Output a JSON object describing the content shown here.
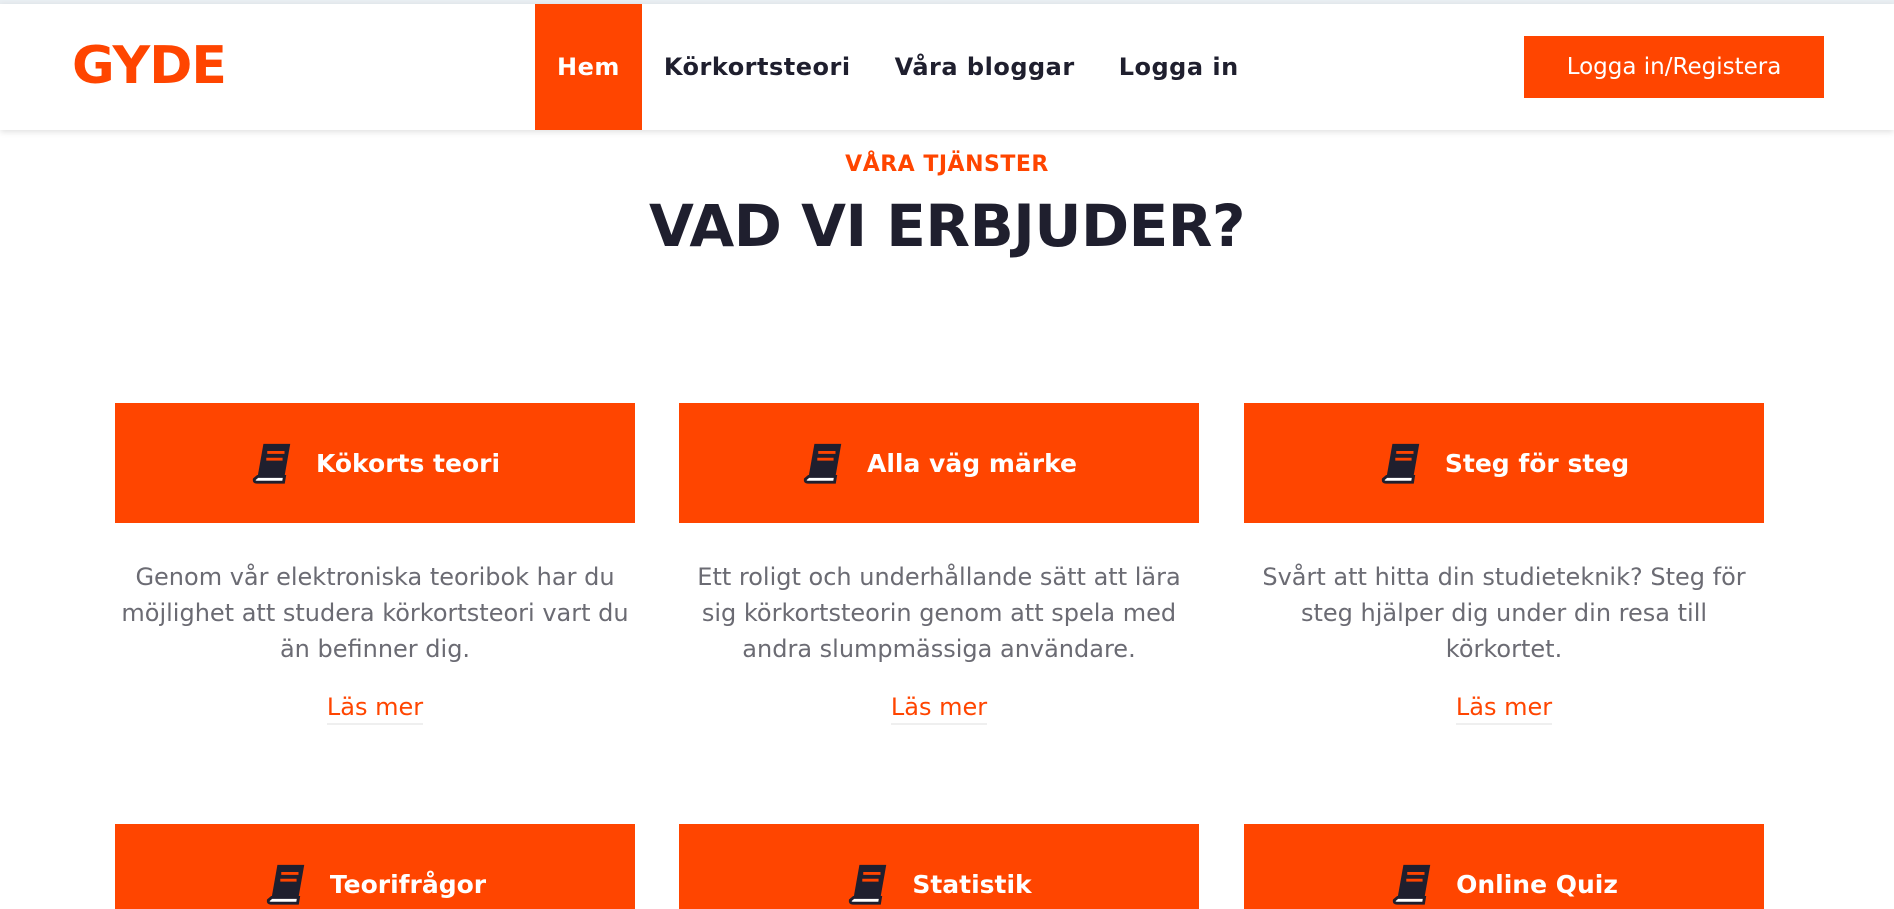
{
  "colors": {
    "accent": "#FF4500",
    "text_dark": "#1F1F2E",
    "text_muted": "#6B6B73"
  },
  "header": {
    "brand": "GYDE",
    "nav": [
      {
        "label": "Hem",
        "active": true
      },
      {
        "label": "Körkortsteori",
        "active": false
      },
      {
        "label": "Våra bloggar",
        "active": false
      },
      {
        "label": "Logga in",
        "active": false
      }
    ],
    "cta_label": "Logga in/Registera"
  },
  "section": {
    "kicker": "VÅRA TJÄNSTER",
    "title": "VAD VI ERBJUDER?"
  },
  "cards": [
    {
      "icon": "book-icon",
      "title": "Kökorts teori",
      "description": "Genom vår elektroniska teoribok har du möjlighet att studera körkortsteori vart du än befinner dig.",
      "link": "Läs mer"
    },
    {
      "icon": "book-icon",
      "title": "Alla väg märke",
      "description": "Ett roligt och underhållande sätt att lära sig körkortsteorin genom att spela med andra slumpmässiga användare.",
      "link": "Läs mer"
    },
    {
      "icon": "book-icon",
      "title": "Steg för steg",
      "description": "Svårt att hitta din studieteknik? Steg för steg hjälper dig under din resa till körkortet.",
      "link": "Läs mer"
    },
    {
      "icon": "book-icon",
      "title": "Teorifrågor"
    },
    {
      "icon": "book-icon",
      "title": "Statistik"
    },
    {
      "icon": "book-icon",
      "title": "Online Quiz"
    }
  ]
}
